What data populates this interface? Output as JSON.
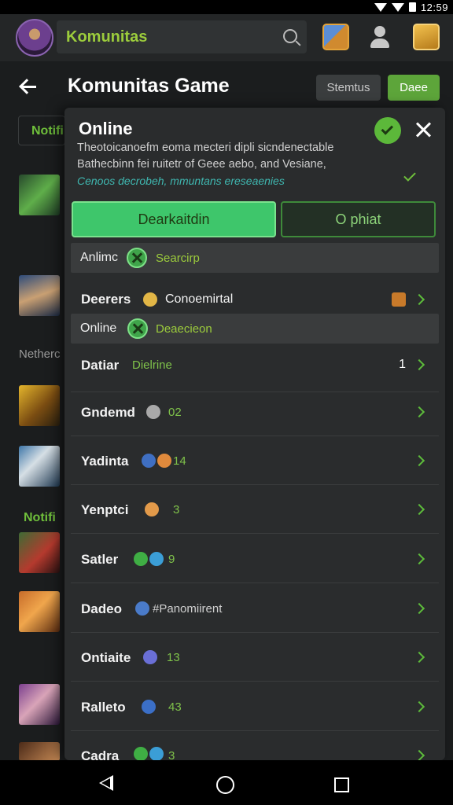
{
  "status_bar": {
    "time": "12:59"
  },
  "app_bar": {
    "search_text": "Komunitas"
  },
  "header": {
    "title": "Komunitas Game",
    "settings_label": "Stemtus",
    "done_label": "Daee"
  },
  "feed": {
    "tab_label": "Notifi",
    "section_label": "Netherc",
    "notif_label": "Notifi"
  },
  "panel": {
    "title": "Online",
    "desc_line1": "Theotoicanoefm eoma mecteri dipli sicndenectable",
    "desc_line2": "Bathecbinn fei ruitetr of Geee aebo, and Vesiane,",
    "desc_line3": "Cenoos decrobeh, mmuntans ereseaenies",
    "tab_left": "Dearkaitdin",
    "tab_right": "O phiat",
    "section1": {
      "label": "Anlimc",
      "sub": "Searcirp"
    },
    "row_first": {
      "label": "Deerers",
      "extra": "Conoemirtal"
    },
    "section2": {
      "label": "Online",
      "sub": "Deaecieon"
    },
    "rows": [
      {
        "label": "Datiar",
        "value": "Dielrine",
        "count": "1"
      },
      {
        "label": "Gndemd",
        "value": "02",
        "count": ""
      },
      {
        "label": "Yadinta",
        "value": "14",
        "count": ""
      },
      {
        "label": "Yenptci",
        "value": "3",
        "count": ""
      },
      {
        "label": "Satler",
        "value": "9",
        "count": ""
      },
      {
        "label": "Dadeo",
        "value": "#Panomiirent",
        "count": ""
      },
      {
        "label": "Ontiaite",
        "value": "13",
        "count": ""
      },
      {
        "label": "Ralleto",
        "value": "43",
        "count": ""
      },
      {
        "label": "Cadra",
        "value": "3",
        "count": ""
      }
    ]
  },
  "colors": {
    "accent": "#5da53a",
    "panel": "#2a2c2d",
    "highlight": "#3ec66b",
    "text_accent": "#9ccc3c"
  },
  "icons": [
    "search-icon",
    "box-icon",
    "profile-icon",
    "chest-icon",
    "back-icon",
    "close-icon",
    "check-icon",
    "chevron-right-icon"
  ]
}
